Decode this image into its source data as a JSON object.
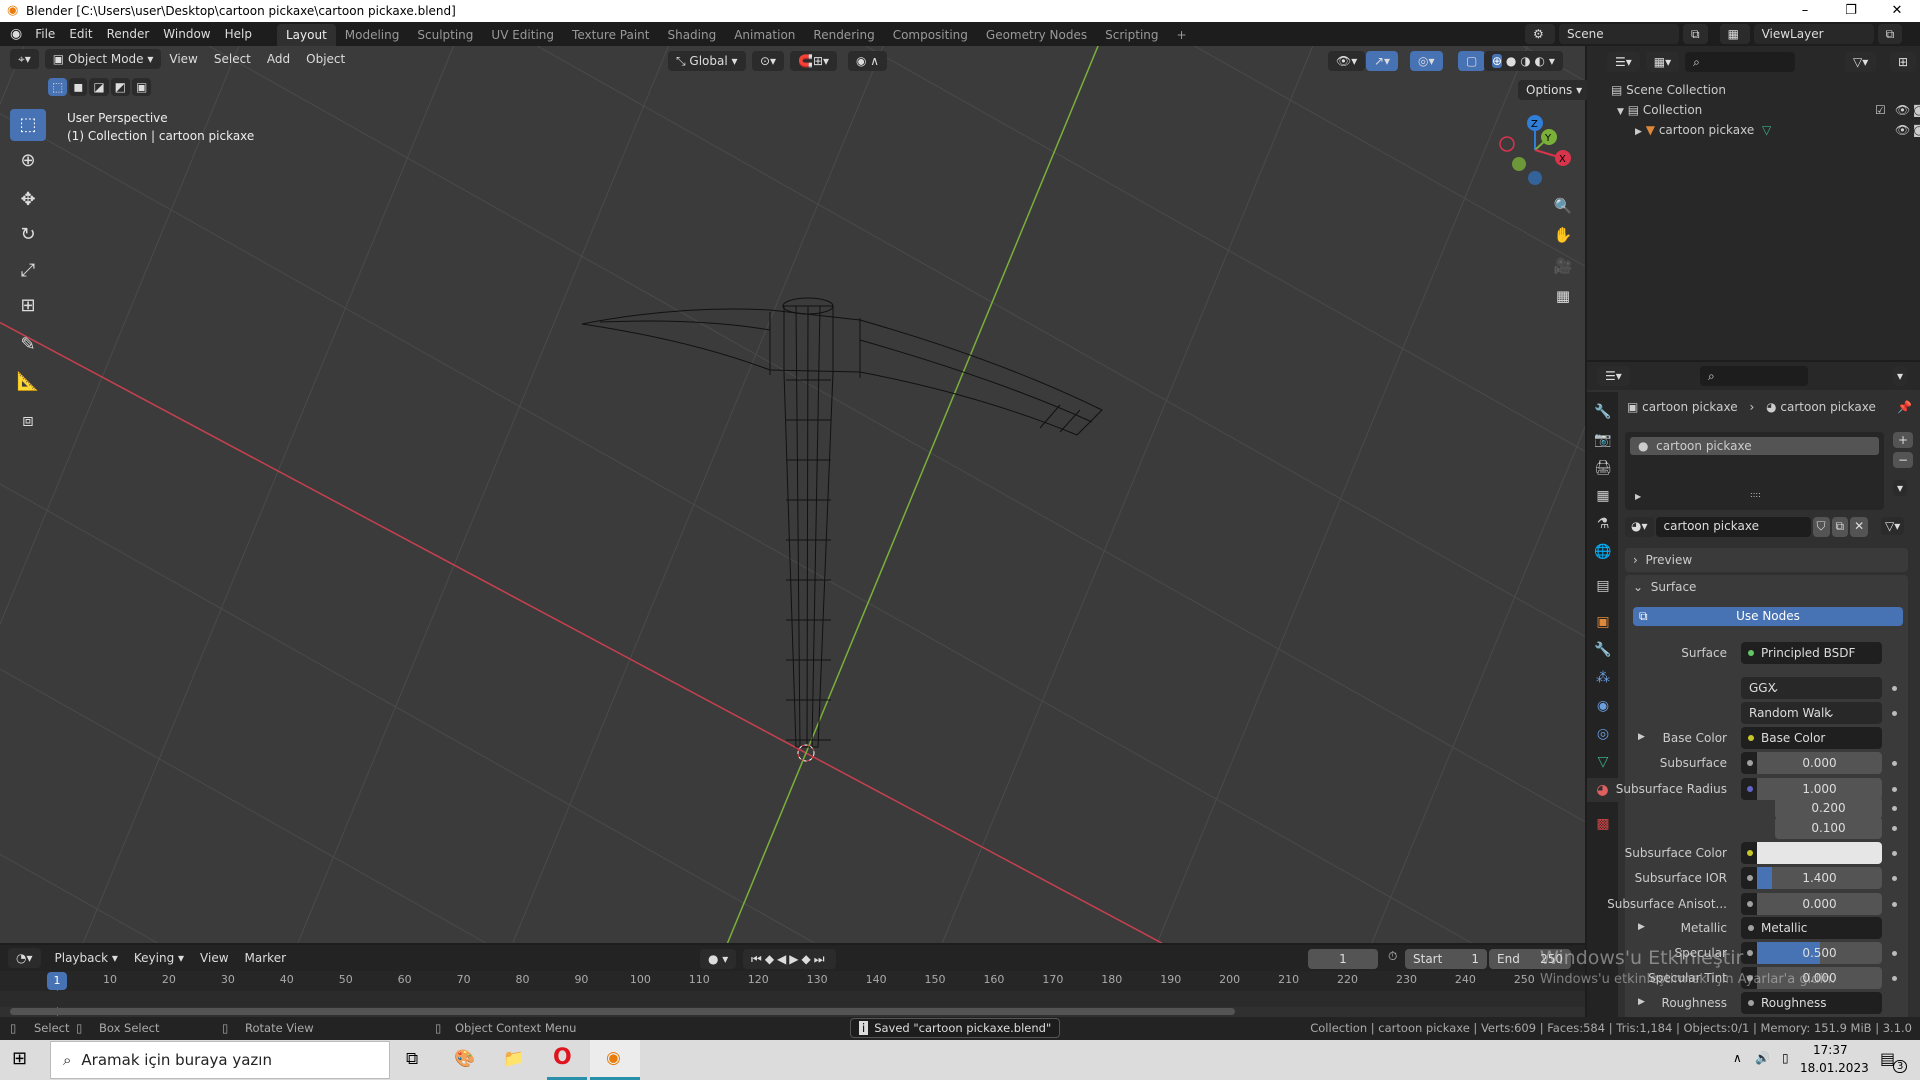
{
  "titlebar": {
    "title": "Blender [C:\\Users\\user\\Desktop\\cartoon pickaxe\\cartoon pickaxe.blend]",
    "minimize": "–",
    "maximize": "❐",
    "close": "✕"
  },
  "menu": {
    "items": [
      "File",
      "Edit",
      "Render",
      "Window",
      "Help"
    ]
  },
  "workspaces": {
    "tabs": [
      "Layout",
      "Modeling",
      "Sculpting",
      "UV Editing",
      "Texture Paint",
      "Shading",
      "Animation",
      "Rendering",
      "Compositing",
      "Geometry Nodes",
      "Scripting"
    ],
    "active": "Layout",
    "add": "+"
  },
  "scene": {
    "scene_name": "Scene",
    "view_layer": "ViewLayer"
  },
  "viewport": {
    "mode": "Object Mode",
    "menus": [
      "View",
      "Select",
      "Add",
      "Object"
    ],
    "orientation": "Global",
    "options": "Options",
    "overlay_title": "User Perspective",
    "overlay_sub": "(1) Collection | cartoon pickaxe",
    "gizmo": {
      "x": "X",
      "y": "Y",
      "z": "Z"
    },
    "colors": {
      "x_axis": "#c7404f",
      "y_axis": "#7ab03a",
      "bg": "#3b3b3b"
    }
  },
  "outliner": {
    "items": [
      {
        "label": "Scene Collection",
        "icon": "collection-icon"
      },
      {
        "label": "Collection",
        "icon": "collection-icon",
        "checked": true
      },
      {
        "label": "cartoon pickaxe",
        "icon": "mesh-object-icon"
      }
    ]
  },
  "properties": {
    "breadcrumb": [
      "cartoon pickaxe",
      "cartoon pickaxe"
    ],
    "slot": "cartoon pickaxe",
    "material_name": "cartoon pickaxe",
    "panels": {
      "preview": "Preview",
      "surface": "Surface"
    },
    "use_nodes": "Use Nodes",
    "rows": [
      {
        "label": "Surface",
        "kind": "link",
        "value": "Principled BSDF",
        "socket": "#63c763"
      },
      {
        "label": "",
        "kind": "menu",
        "value": "GGX"
      },
      {
        "label": "",
        "kind": "menu",
        "value": "Random Walk"
      },
      {
        "label": "Base Color",
        "kind": "link",
        "value": "Base Color",
        "socket": "#c7c729",
        "expand": true
      },
      {
        "label": "Subsurface",
        "kind": "num",
        "value": "0.000",
        "socket": "#a1a1a1",
        "fill": 0
      },
      {
        "label": "Subsurface Radius",
        "kind": "num",
        "value": "1.000",
        "socket": "#6363c7",
        "fill": 0
      },
      {
        "label": "",
        "kind": "num",
        "value": "0.200",
        "fill": 0
      },
      {
        "label": "",
        "kind": "num",
        "value": "0.100",
        "fill": 0
      },
      {
        "label": "Subsurface Color",
        "kind": "color",
        "value": "",
        "socket": "#c7c729",
        "color": "#e6e6e6"
      },
      {
        "label": "Subsurface IOR",
        "kind": "num",
        "value": "1.400",
        "socket": "#a1a1a1",
        "fill": 0.12
      },
      {
        "label": "Subsurface Anisot...",
        "kind": "num",
        "value": "0.000",
        "socket": "#a1a1a1",
        "fill": 0
      },
      {
        "label": "Metallic",
        "kind": "link",
        "value": "Metallic",
        "socket": "#a1a1a1",
        "expand": true
      },
      {
        "label": "Specular",
        "kind": "num",
        "value": "0.500",
        "socket": "#a1a1a1",
        "fill": 0.5
      },
      {
        "label": "Specular Tint",
        "kind": "num",
        "value": "0.000",
        "socket": "#a1a1a1",
        "fill": 0
      },
      {
        "label": "Roughness",
        "kind": "link",
        "value": "Roughness",
        "socket": "#a1a1a1",
        "expand": true
      }
    ]
  },
  "timeline": {
    "menus": [
      "Playback",
      "Keying",
      "View",
      "Marker"
    ],
    "current_frame": "1",
    "start_label": "Start",
    "start": "1",
    "end_label": "End",
    "end": "250",
    "ticks": [
      "10",
      "20",
      "30",
      "40",
      "50",
      "60",
      "70",
      "80",
      "90",
      "100",
      "110",
      "120",
      "130",
      "140",
      "150",
      "160",
      "170",
      "180",
      "190",
      "200",
      "210",
      "220",
      "230",
      "240",
      "250"
    ],
    "playhead": "1"
  },
  "statusbar": {
    "hints": [
      "Select",
      "Box Select",
      "Rotate View",
      "Object Context Menu"
    ],
    "message": "Saved \"cartoon pickaxe.blend\"",
    "stats": "Collection | cartoon pickaxe | Verts:609 | Faces:584 | Tris:1,184 | Objects:0/1 | Memory: 151.9 MiB | 3.1.0"
  },
  "watermark": {
    "line1": "Windows'u Etkinleştir",
    "line2": "Windows'u etkinleştirmek için Ayarlar'a gidin."
  },
  "taskbar": {
    "search_placeholder": "Aramak için buraya yazın",
    "time": "17:37",
    "date": "18.01.2023",
    "notifications": "3"
  }
}
